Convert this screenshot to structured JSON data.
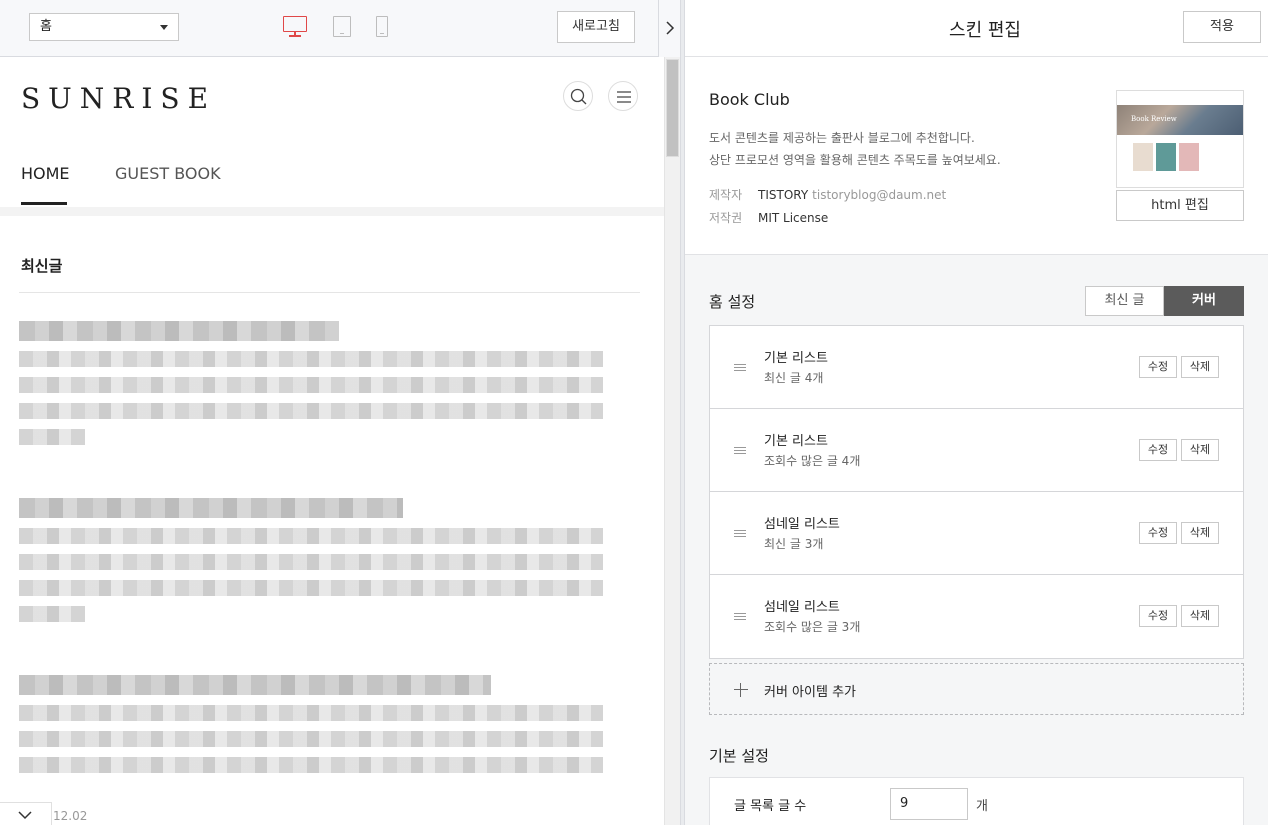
{
  "toolbar": {
    "page_select_value": "홈",
    "refresh_label": "새로고침"
  },
  "preview": {
    "blog_title": "SUNRISE",
    "nav": [
      "HOME",
      "GUEST BOOK"
    ],
    "section_title": "최신글",
    "partial_date": "12.02"
  },
  "editor": {
    "title": "스킨 편집",
    "apply_label": "적용",
    "skin": {
      "name": "Book Club",
      "description_line1": "도서 콘텐츠를 제공하는 출판사 블로그에 추천합니다.",
      "description_line2": "상단 프로모션 영역을 활용해 콘텐츠 주목도를 높여보세요.",
      "author_label": "제작자",
      "author_name": "TISTORY",
      "author_email": "tistoryblog@daum.net",
      "license_label": "저작권",
      "license_value": "MIT License",
      "thumb_hero_text": "Book Review",
      "html_edit_label": "html 편집"
    },
    "home_settings": {
      "label": "홈 설정",
      "tab_latest": "최신 글",
      "tab_cover": "커버",
      "items": [
        {
          "title": "기본 리스트",
          "subtitle": "최신 글 4개"
        },
        {
          "title": "기본 리스트",
          "subtitle": "조회수 많은 글 4개"
        },
        {
          "title": "섬네일 리스트",
          "subtitle": "최신 글 3개"
        },
        {
          "title": "섬네일 리스트",
          "subtitle": "조회수 많은 글 3개"
        }
      ],
      "edit_label": "수정",
      "delete_label": "삭제",
      "add_cover_label": "커버 아이템 추가"
    },
    "basic_settings": {
      "label": "기본 설정",
      "post_count_label": "글 목록 글 수",
      "post_count_value": "9",
      "post_count_unit": "개"
    }
  },
  "colors": {
    "accent_red": "#e04848",
    "active_tab": "#5b5b5b"
  }
}
